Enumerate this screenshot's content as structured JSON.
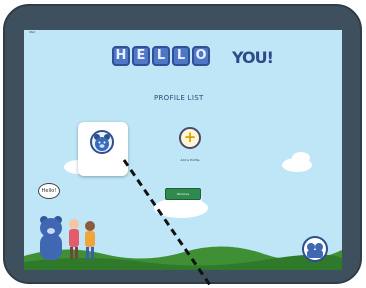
{
  "status_bar": {
    "left": "iPad",
    "center": "",
    "right": ""
  },
  "logo": {
    "letters": [
      "H",
      "E",
      "L",
      "L",
      "O"
    ],
    "suffix": "YOU!"
  },
  "screen_title": "PROFILE LIST",
  "profiles": [
    {
      "name": "",
      "avatar_icon": "bear-icon"
    }
  ],
  "add_profile": {
    "label": "Add a Profile",
    "icon": "plus-icon"
  },
  "remove_button": {
    "label": "Remove"
  },
  "speech_bubble": "Hello!",
  "corner_badge": {
    "label": "",
    "icon": "bear-family-icon"
  },
  "colors": {
    "sky": "#bfe6f6",
    "tile": "#4f77c6",
    "remove": "#2f8a4f",
    "ground": "#3f8f35",
    "frame": "#3e4f5d"
  }
}
